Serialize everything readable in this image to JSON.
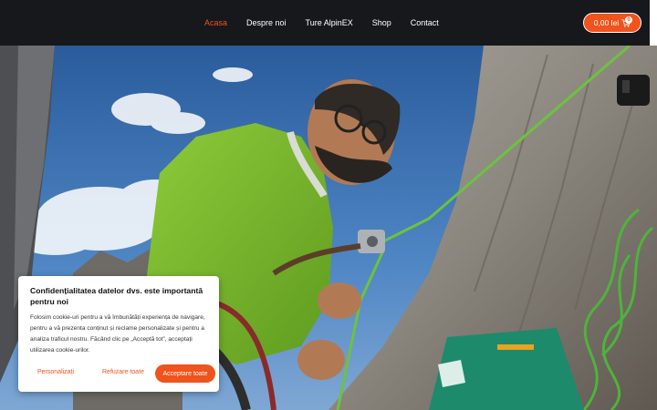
{
  "nav": {
    "items": [
      {
        "label": "Acasa",
        "active": true
      },
      {
        "label": "Despre noi",
        "active": false
      },
      {
        "label": "Ture AlpinEX",
        "active": false
      },
      {
        "label": "Shop",
        "active": false
      },
      {
        "label": "Contact",
        "active": false
      }
    ],
    "cart": {
      "amount": "0,00 lei",
      "count": "0",
      "icon": "cart-icon"
    }
  },
  "hero": {
    "image": "climber-photo"
  },
  "cookie": {
    "title": "Confidențialitatea datelor dvs. este importantă pentru noi",
    "body": "Folosim cookie-uri pentru a vă îmbunătăți experiența de navigare, pentru a vă prezenta conținut și reclame personalizate și pentru a analiza traficul nostru. Făcând clic pe „Acceptă tot”, acceptați utilizarea cookie-urilor.",
    "personalize_label": "Personalizați",
    "reject_label": "Refuzare toate",
    "accept_label": "Acceptare toate"
  },
  "colors": {
    "accent": "#f0531c",
    "nav_bg": "#16181b"
  }
}
